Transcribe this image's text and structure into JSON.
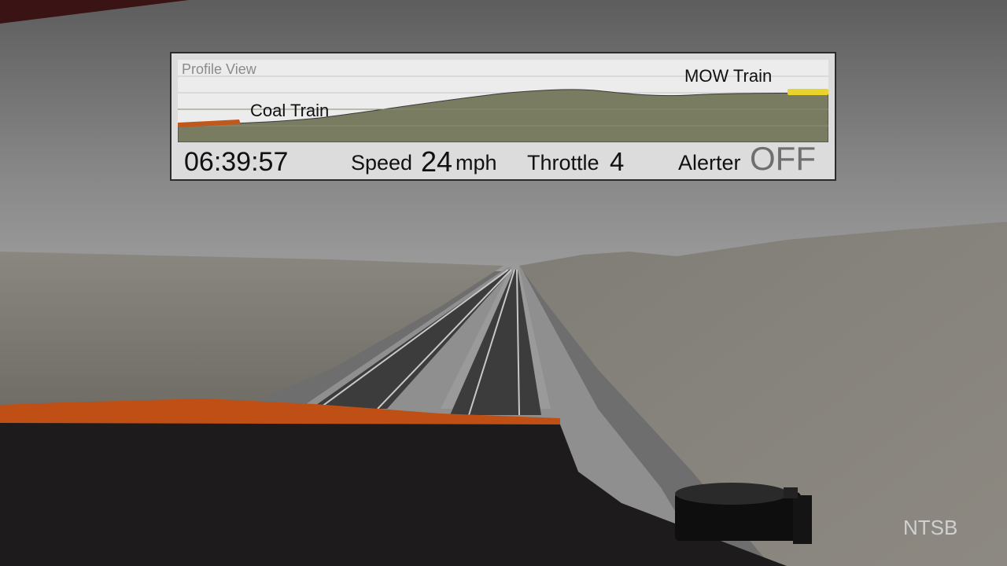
{
  "profile": {
    "title": "Profile View",
    "coal_train_label": "Coal Train",
    "mow_train_label": "MOW Train"
  },
  "status": {
    "clock": "06:39:57",
    "speed_label": "Speed",
    "speed_value": "24",
    "speed_unit": "mph",
    "throttle_label": "Throttle",
    "throttle_value": "4",
    "alerter_label": "Alerter",
    "alerter_value": "OFF"
  },
  "watermark": "NTSB",
  "colors": {
    "terrain": "#7a7c62",
    "coal_train": "#c0581e",
    "mow_train": "#e8d42a",
    "locomotive_hood": "#bf4f14",
    "sky": "#707070",
    "ground": "#7e7a73"
  }
}
